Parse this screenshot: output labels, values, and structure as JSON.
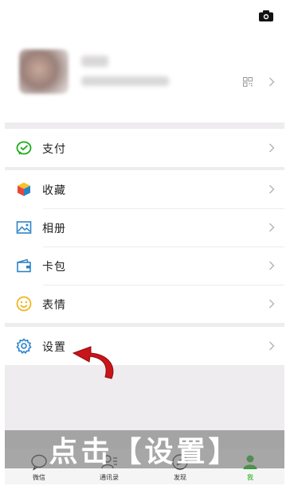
{
  "menu": {
    "pay": {
      "label": "支付",
      "icon": "wechat-pay-icon"
    },
    "collections": {
      "label": "收藏",
      "icon": "favorites-cube-icon"
    },
    "album": {
      "label": "相册",
      "icon": "photo-album-icon"
    },
    "cards": {
      "label": "卡包",
      "icon": "card-wallet-icon"
    },
    "stickers": {
      "label": "表情",
      "icon": "smiley-icon"
    },
    "settings": {
      "label": "设置",
      "icon": "gear-icon"
    }
  },
  "annotation": {
    "text": "点击【设置】"
  },
  "tabbar": {
    "tabs": [
      {
        "label": "微信",
        "icon": "chat-bubble-icon",
        "active": false
      },
      {
        "label": "通讯录",
        "icon": "contacts-icon",
        "active": false
      },
      {
        "label": "发现",
        "icon": "compass-icon",
        "active": false
      },
      {
        "label": "我",
        "icon": "person-icon",
        "active": true
      }
    ]
  },
  "colors": {
    "accent": "#1aad19",
    "arrow": "#c9141a",
    "icon_blue": "#2b83c9",
    "background": "#eeecee"
  }
}
